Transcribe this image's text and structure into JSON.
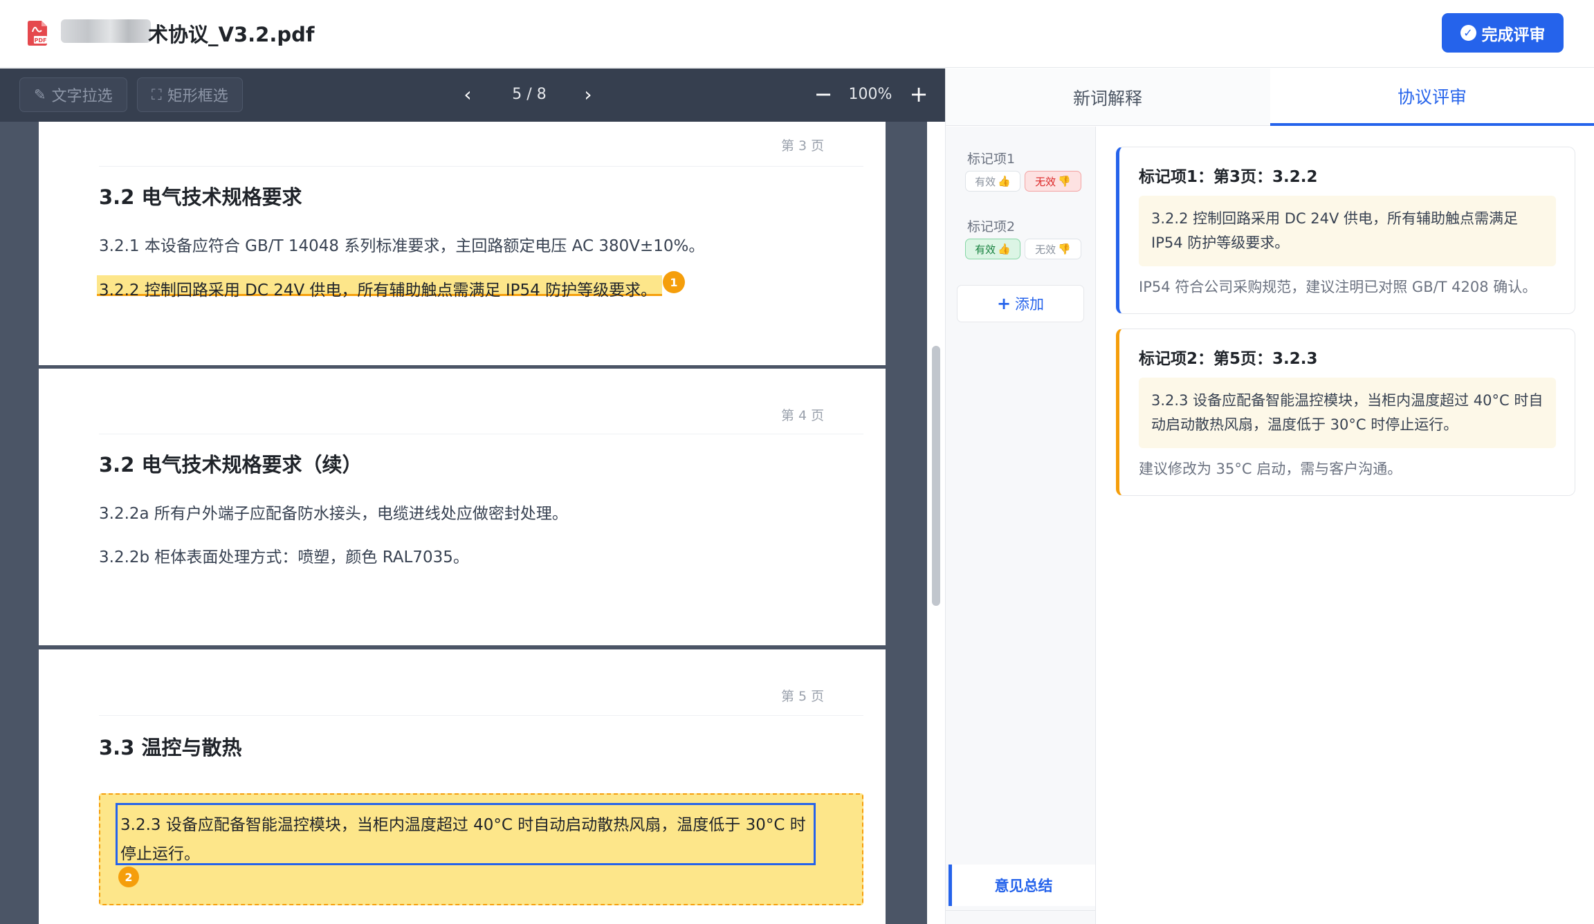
{
  "header": {
    "file_title": "术协议_V3.2.pdf",
    "finish_label": "完成评审"
  },
  "toolbar": {
    "text_select_label": "文字拉选",
    "rect_select_label": "矩形框选",
    "page_indicator": "5 / 8",
    "zoom_level": "100%"
  },
  "pages": [
    {
      "page_label": "第 3 页",
      "section_title": "3.2 电气技术规格要求",
      "paragraphs": [
        "3.2.1 本设备应符合 GB/T 14048 系列标准要求，主回路额定电压 AC 380V±10%。"
      ],
      "highlight_text": "3.2.2 控制回路采用 DC 24V 供电，所有辅助触点需满足 IP54 防护等级要求。",
      "highlight_badge": "1"
    },
    {
      "page_label": "第 4 页",
      "section_title": "3.2 电气技术规格要求（续）",
      "paragraphs": [
        "3.2.2a 所有户外端子应配备防水接头，电缆进线处应做密封处理。",
        "3.2.2b 柜体表面处理方式：喷塑，颜色 RAL7035。"
      ]
    },
    {
      "page_label": "第 5 页",
      "section_title": "3.3 温控与散热",
      "highlight_lines": [
        "3.2.3 设备应配备智能温控模块，当柜内温度超过 40°C 时自动启动散热风扇，温度低于 30°C 时",
        "停止运行。"
      ],
      "highlight_badge": "2"
    }
  ],
  "tabs": {
    "glossary": "新词解释",
    "review": "协议评审"
  },
  "marks": [
    {
      "label": "标记项1",
      "valid": "有效",
      "invalid": "无效",
      "status": "invalid"
    },
    {
      "label": "标记项2",
      "valid": "有效",
      "invalid": "无效",
      "status": "valid"
    }
  ],
  "add_label": "添加",
  "summary_label": "意见总结",
  "cards": [
    {
      "title": "标记项1：第3页：3.2.2",
      "quote": "3.2.2 控制回路采用 DC 24V 供电，所有辅助触点需满足 IP54 防护等级要求。",
      "comment": "IP54 符合公司采购规范，建议注明已对照 GB/T 4208 确认。",
      "accent": "#2563eb"
    },
    {
      "title": "标记项2：第5页：3.2.3",
      "quote": "3.2.3 设备应配备智能温控模块，当柜内温度超过 40°C 时自动启动散热风扇，温度低于 30°C 时停止运行。",
      "comment": "建议修改为 35°C 启动，需与客户沟通。",
      "accent": "#f59e0b"
    }
  ],
  "colors": {
    "primary": "#2563eb",
    "highlight": "#fde68a",
    "highlight_border": "#f59e0b",
    "invalid": "#dc2626",
    "valid": "#15803d"
  }
}
